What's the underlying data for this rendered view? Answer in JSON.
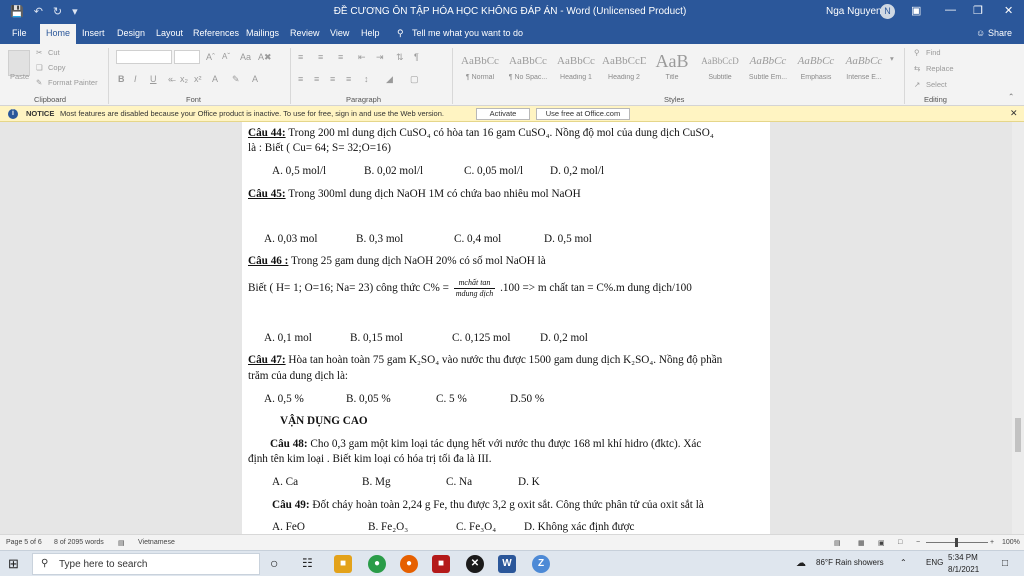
{
  "titlebar": {
    "title": "ĐỀ CƯƠNG ÔN TẬP HÓA HỌC KHÔNG ĐÁP ÁN  -  Word (Unlicensed Product)",
    "user": "Nga Nguyen",
    "initials": "N"
  },
  "menu": {
    "tabs": [
      "File",
      "Home",
      "Insert",
      "Design",
      "Layout",
      "References",
      "Mailings",
      "Review",
      "View",
      "Help"
    ],
    "tell_me": "Tell me what you want to do",
    "share": "Share"
  },
  "ribbon": {
    "clipboard": {
      "paste": "Paste",
      "cut": "Cut",
      "copy": "Copy",
      "format_painter": "Format Painter",
      "label": "Clipboard"
    },
    "font_label": "Font",
    "paragraph_label": "Paragraph",
    "styles": [
      {
        "preview": "AaBbCc",
        "label": "¶ Normal"
      },
      {
        "preview": "AaBbCc",
        "label": "¶ No Spac..."
      },
      {
        "preview": "AaBbCc",
        "label": "Heading 1"
      },
      {
        "preview": "AaBbCcD",
        "label": "Heading 2"
      },
      {
        "preview": "AaB",
        "label": "Title"
      },
      {
        "preview": "AaBbCcD",
        "label": "Subtitle"
      },
      {
        "preview": "AaBbCc",
        "label": "Subtle Em..."
      },
      {
        "preview": "AaBbCc",
        "label": "Emphasis"
      },
      {
        "preview": "AaBbCc",
        "label": "Intense E..."
      }
    ],
    "styles_label": "Styles",
    "editing": {
      "find": "Find",
      "replace": "Replace",
      "select": "Select",
      "label": "Editing"
    }
  },
  "notice": {
    "badge": "NOTICE",
    "text": "Most features are disabled because your Office product is inactive. To use for free, sign in and use the Web version.",
    "activate": "Activate",
    "use_free": "Use free at Office.com"
  },
  "doc": {
    "q44_label": "Câu 44:",
    "q44_text": " Trong 200 ml dung dịch CuSO₄ có hòa tan 16 gam CuSO₄. Nồng độ mol của dung dịch CuSO₄",
    "q44_text2": "là : Biết ( Cu= 64; S= 32;O=16)",
    "q44_answers": [
      "A. 0,5 mol/l",
      "B. 0,02 mol/l",
      "C. 0,05 mol/l",
      "D. 0,2 mol/l"
    ],
    "q45_label": "Câu 45:",
    "q45_text": " Trong 300ml dung dịch NaOH 1M có chứa bao nhiêu mol NaOH",
    "q45_answers": [
      "A. 0,03 mol",
      "B. 0,3 mol",
      "C. 0,4 mol",
      "D. 0,5 mol"
    ],
    "q46_label": "Câu 46 :",
    "q46_text": " Trong 25 gam dung dịch NaOH 20% có số mol NaOH là",
    "q46_formula_pre": "Biết ( H= 1; O=16; Na= 23) công thức C% = ",
    "q46_frac_num": "mchất tan",
    "q46_frac_den": "mdung dịch",
    "q46_formula_post": " .100 => m chất tan = C%.m dung dịch/100",
    "q46_answers": [
      "A. 0,1 mol",
      "B. 0,15 mol",
      "C. 0,125 mol",
      "D. 0,2 mol"
    ],
    "q47_label": "Câu 47:",
    "q47_text": " Hòa tan hoàn toàn 75 gam K₂SO₄ vào nước thu được 1500 gam dung dịch K₂SO₄. Nồng độ phần",
    "q47_text2": "trăm của dung dịch là:",
    "q47_answers": [
      "A. 0,5 %",
      "B. 0,05 %",
      "C. 5 %",
      "D.50 %"
    ],
    "section": "VẬN DỤNG CAO",
    "q48_label": "Câu 48:",
    "q48_text": " Cho 0,3 gam một kim loại tác dụng hết với nước thu được 168 ml khí hidro (đktc). Xác",
    "q48_text2": "định tên kim loại . Biết kim loại có hóa trị tối đa là III.",
    "q48_answers": [
      "A. Ca",
      "B. Mg",
      "C. Na",
      "D. K"
    ],
    "q49_label": "Câu 49:",
    "q49_text": " Đốt cháy hoàn toàn 2,24 g Fe, thu được 3,2 g oxit sắt.  Công thức phân tử của oxit sắt là",
    "q49_answers": [
      "A. FeO",
      "B. Fe₂O₃",
      "C. Fe₃O₄",
      "D. Không xác định được"
    ]
  },
  "status": {
    "page": "Page 5 of 6",
    "words": "8 of 2095 words",
    "language": "Vietnamese",
    "zoom": "100%"
  },
  "taskbar": {
    "search_placeholder": "Type here to search",
    "weather": "86°F  Rain showers",
    "lang": "ENG",
    "time": "5:34 PM",
    "date": "8/1/2021"
  },
  "colors": {
    "word_blue": "#2b579a",
    "notice_bg": "#fff4c2",
    "page": "#ffffff"
  }
}
